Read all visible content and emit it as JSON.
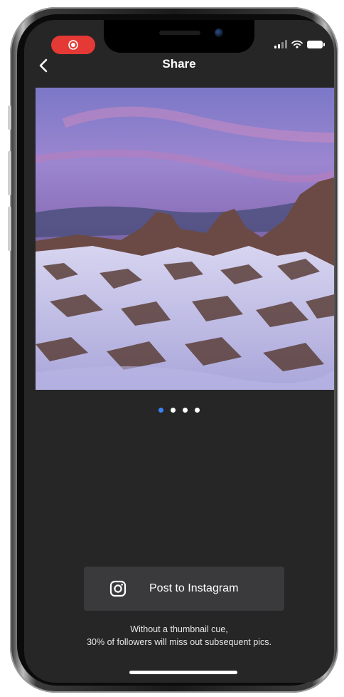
{
  "header": {
    "title": "Share"
  },
  "carousel": {
    "page_count": 4,
    "active_index": 0,
    "active_color": "#3b82f6"
  },
  "post_button": {
    "label": "Post to Instagram"
  },
  "caption": {
    "line1": "Without a thumbnail cue,",
    "line2": "30% of followers will miss out subsequent pics."
  },
  "icons": {
    "back": "chevron-left-icon",
    "instagram": "instagram-icon",
    "record": "screen-record-icon",
    "signal": "cellular-signal-icon",
    "wifi": "wifi-icon",
    "battery": "battery-icon"
  },
  "colors": {
    "screen_bg": "#262626",
    "button_bg": "#3a3a3d",
    "record_red": "#e53935"
  }
}
